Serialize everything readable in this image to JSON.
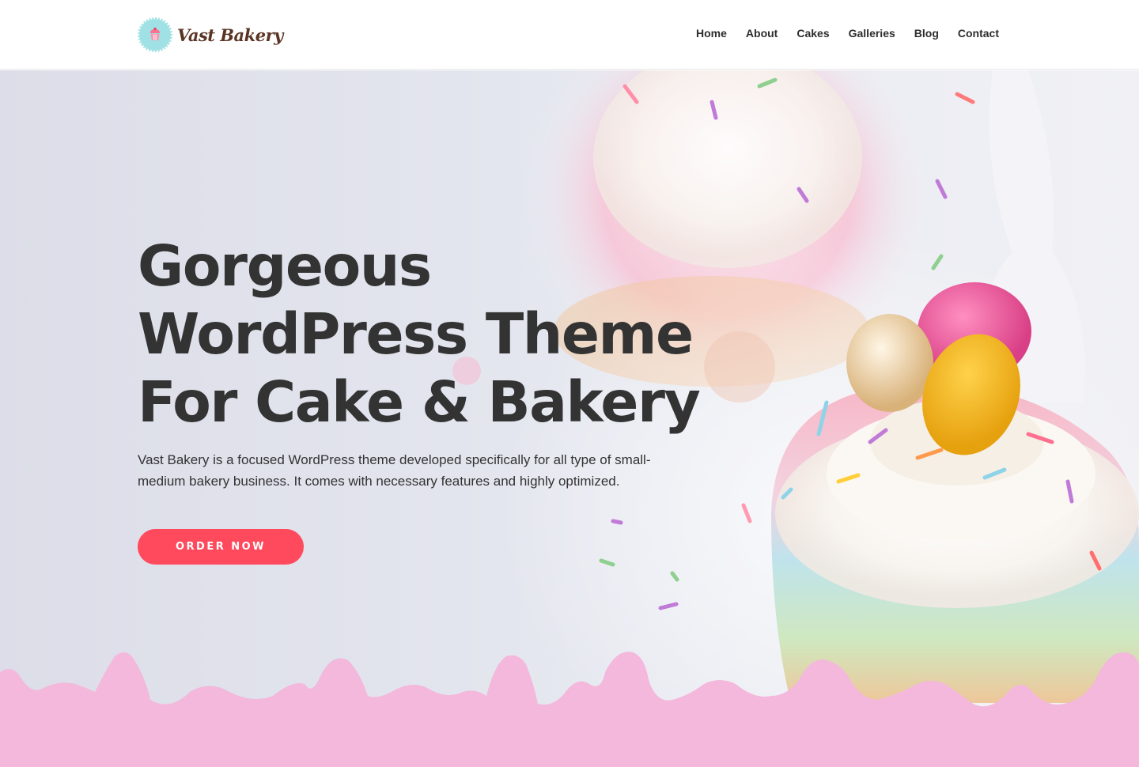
{
  "brand": {
    "name": "Vast Bakery",
    "badge_color": "#9fe1e4"
  },
  "nav": {
    "items": [
      {
        "label": "Home"
      },
      {
        "label": "About"
      },
      {
        "label": "Cakes"
      },
      {
        "label": "Galleries"
      },
      {
        "label": "Blog"
      },
      {
        "label": "Contact"
      }
    ]
  },
  "hero": {
    "title_lines": [
      "Gorgeous",
      "WordPress Theme",
      "For Cake & Bakery"
    ],
    "description": "Vast Bakery is a focused WordPress theme developed specifically for all type of small-medium bakery business. It comes with necessary features and highly optimized.",
    "cta_label": "ORDER NOW",
    "cta_color": "#ff4a5e",
    "drip_color": "#f3b8db"
  }
}
